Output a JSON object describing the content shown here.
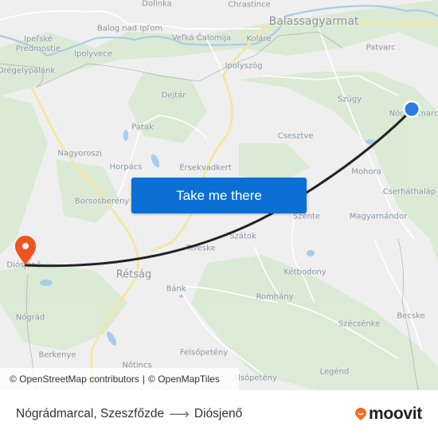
{
  "map": {
    "places": [
      {
        "name": "Dolinka",
        "cls": ""
      },
      {
        "name": "Chrastince",
        "cls": ""
      },
      {
        "name": "Balassagyarmat",
        "cls": "big"
      },
      {
        "name": "Balog nad Ipľom",
        "cls": ""
      },
      {
        "name": "Veľká Čalomija",
        "cls": ""
      },
      {
        "name": "Koláre",
        "cls": ""
      },
      {
        "name": "Ipeľské Predmostie",
        "cls": ""
      },
      {
        "name": "Ipolyvece",
        "cls": ""
      },
      {
        "name": "Drégelypalánk",
        "cls": ""
      },
      {
        "name": "Ipolyszög",
        "cls": ""
      },
      {
        "name": "Patvarc",
        "cls": ""
      },
      {
        "name": "Dejtár",
        "cls": ""
      },
      {
        "name": "Szügy",
        "cls": ""
      },
      {
        "name": "Nógrádmarcal",
        "cls": ""
      },
      {
        "name": "Patak",
        "cls": ""
      },
      {
        "name": "Csesztve",
        "cls": ""
      },
      {
        "name": "Nagyoroszi",
        "cls": ""
      },
      {
        "name": "Horpács",
        "cls": ""
      },
      {
        "name": "Érsekvadkert",
        "cls": ""
      },
      {
        "name": "Mohora",
        "cls": ""
      },
      {
        "name": "Cserháthaláp",
        "cls": ""
      },
      {
        "name": "Borsosberény",
        "cls": ""
      },
      {
        "name": "Szente",
        "cls": ""
      },
      {
        "name": "Magyarnándor",
        "cls": ""
      },
      {
        "name": "Szátok",
        "cls": ""
      },
      {
        "name": "Tereske",
        "cls": ""
      },
      {
        "name": "Diósjenő",
        "cls": ""
      },
      {
        "name": "Rétság",
        "cls": "mid"
      },
      {
        "name": "Kétbodony",
        "cls": ""
      },
      {
        "name": "Bánk",
        "cls": ""
      },
      {
        "name": "Romhány",
        "cls": ""
      },
      {
        "name": "Nógrád",
        "cls": ""
      },
      {
        "name": "Szécsénke",
        "cls": ""
      },
      {
        "name": "Becske",
        "cls": ""
      },
      {
        "name": "Berkenye",
        "cls": ""
      },
      {
        "name": "Felsőpetény",
        "cls": ""
      },
      {
        "name": "Nőtincs",
        "cls": ""
      },
      {
        "name": "Alsópetény",
        "cls": ""
      },
      {
        "name": "Legénd",
        "cls": ""
      }
    ],
    "origin_marker_color": "#2a7de1",
    "destination_marker_color": "#f0541e",
    "route_color": "#222222"
  },
  "cta": {
    "label": "Take me there",
    "color": "#0b6fd3"
  },
  "attribution": {
    "osm": "© OpenStreetMap contributors",
    "separator": "|",
    "omt": "© OpenMapTiles"
  },
  "footer": {
    "origin": "Nógrádmarcal, Szeszfőzde",
    "arrow": "⟶",
    "destination": "Diósjenő",
    "brand": "moovit",
    "brand_color": "#f56a1f"
  }
}
